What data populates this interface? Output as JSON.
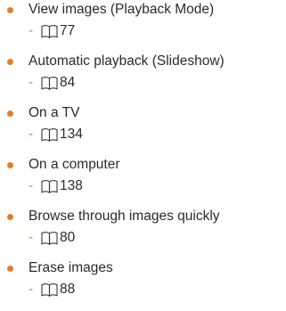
{
  "accent_color": "#e07f2a",
  "text_color": "#2b2b2b",
  "reference_icon": "book-icon",
  "items": [
    {
      "title": "View images (Playback Mode)",
      "dash": "-",
      "page": "77"
    },
    {
      "title": "Automatic playback (Slideshow)",
      "dash": "-",
      "page": "84"
    },
    {
      "title": "On a TV",
      "dash": "-",
      "page": "134"
    },
    {
      "title": "On a computer",
      "dash": "-",
      "page": "138"
    },
    {
      "title": "Browse through images quickly",
      "dash": "-",
      "page": "80"
    },
    {
      "title": "Erase images",
      "dash": "-",
      "page": "88"
    }
  ]
}
